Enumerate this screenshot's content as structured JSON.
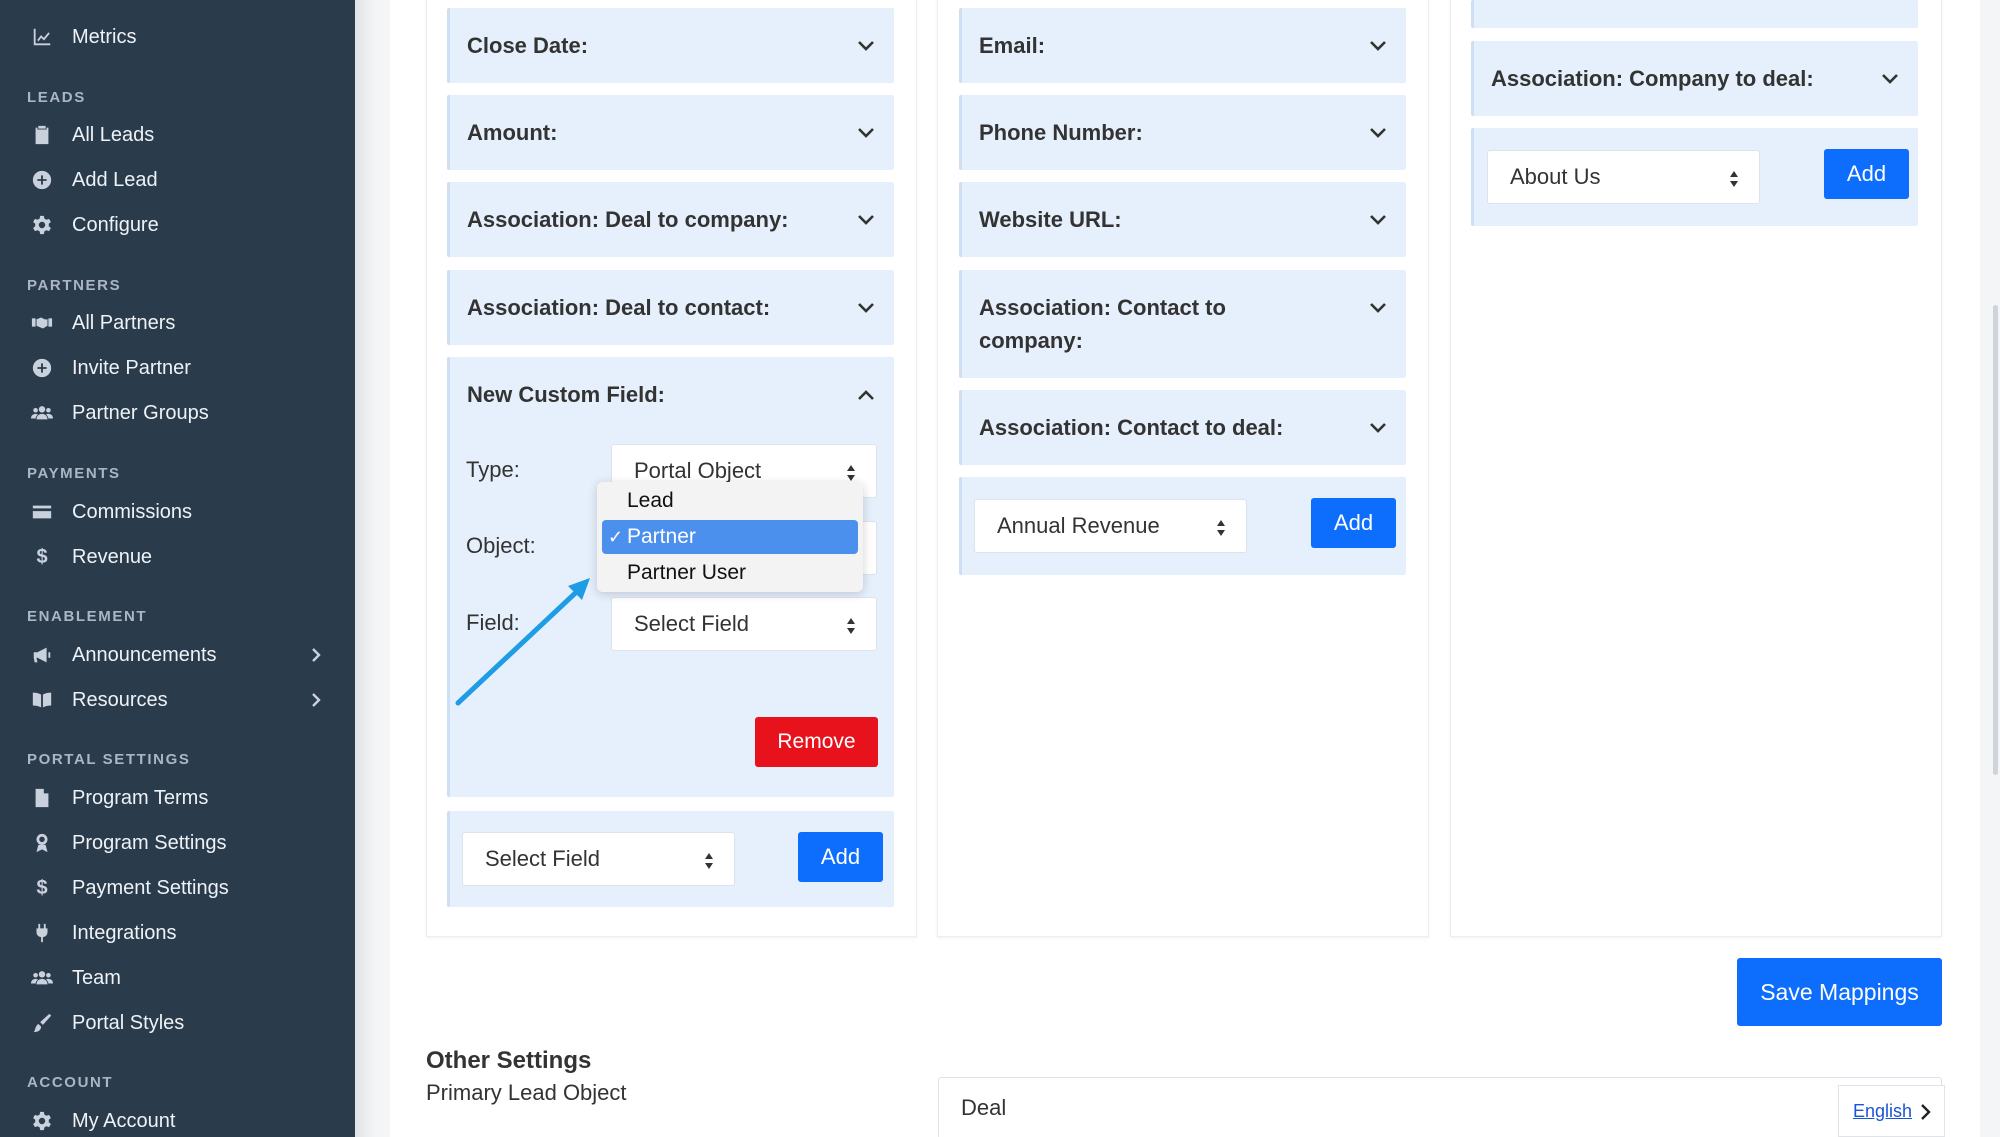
{
  "sidebar": {
    "items": [
      {
        "label": "Metrics",
        "icon": "chart-line-icon"
      },
      {
        "label": "All Leads",
        "icon": "clipboard-icon"
      },
      {
        "label": "Add Lead",
        "icon": "plus-circle-icon"
      },
      {
        "label": "Configure",
        "icon": "gear-icon"
      },
      {
        "label": "All Partners",
        "icon": "handshake-icon"
      },
      {
        "label": "Invite Partner",
        "icon": "plus-circle-icon"
      },
      {
        "label": "Partner Groups",
        "icon": "users-icon"
      },
      {
        "label": "Commissions",
        "icon": "credit-card-icon"
      },
      {
        "label": "Revenue",
        "icon": "dollar-icon"
      },
      {
        "label": "Announcements",
        "icon": "megaphone-icon"
      },
      {
        "label": "Resources",
        "icon": "book-icon"
      },
      {
        "label": "Program Terms",
        "icon": "file-icon"
      },
      {
        "label": "Program Settings",
        "icon": "award-icon"
      },
      {
        "label": "Payment Settings",
        "icon": "dollar-icon"
      },
      {
        "label": "Integrations",
        "icon": "plug-icon"
      },
      {
        "label": "Team",
        "icon": "users-icon"
      },
      {
        "label": "Portal Styles",
        "icon": "brush-icon"
      },
      {
        "label": "My Account",
        "icon": "gear-icon"
      }
    ],
    "sections": {
      "leads": "LEADS",
      "partners": "PARTNERS",
      "payments": "PAYMENTS",
      "enablement": "ENABLEMENT",
      "portal_settings": "PORTAL SETTINGS",
      "account": "ACCOUNT"
    }
  },
  "col1": {
    "fields": [
      "Close Date:",
      "Amount:",
      "Association: Deal to company:",
      "Association: Deal to contact:"
    ],
    "custom_field": {
      "title": "New Custom Field:",
      "type_label": "Type:",
      "type_value": "Portal Object",
      "object_label": "Object:",
      "field_label": "Field:",
      "field_value": "Select Field",
      "remove_label": "Remove"
    },
    "add_select": "Select Field",
    "add_label": "Add"
  },
  "dropdown": {
    "options": [
      "Lead",
      "Partner",
      "Partner User"
    ],
    "selected": "Partner"
  },
  "col2": {
    "fields": [
      "Email:",
      "Phone Number:",
      "Website URL:",
      "Association: Contact to company:",
      "Association: Contact to deal:"
    ],
    "add_select": "Annual Revenue",
    "add_label": "Add"
  },
  "col3": {
    "fields": [
      "Association: Company to deal:"
    ],
    "add_select": "About Us",
    "add_label": "Add"
  },
  "save_label": "Save Mappings",
  "other": {
    "title": "Other Settings",
    "primary_label": "Primary Lead Object",
    "primary_value": "Deal"
  },
  "lang": "English",
  "colors": {
    "sidebar": "#2a3b4c",
    "accordion": "#e6f0fc",
    "primary": "#0d6efd",
    "danger": "#e8121d",
    "annotation_arrow": "#1e9ce6"
  }
}
